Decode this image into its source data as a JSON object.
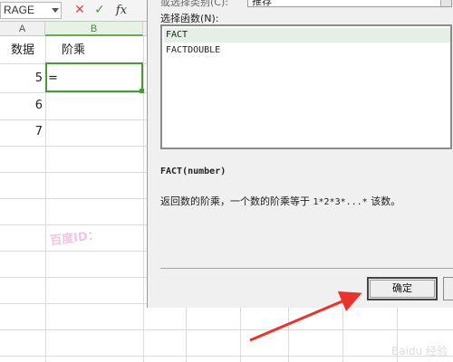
{
  "formula_bar": {
    "name_box": "RAGE",
    "cancel_icon": "✕",
    "enter_icon": "✓",
    "fx_label": "fx"
  },
  "spreadsheet": {
    "columns": [
      "A",
      "B"
    ],
    "rows": [
      {
        "a": "数据",
        "b": "阶乘"
      },
      {
        "a": "5",
        "b": "="
      },
      {
        "a": "6",
        "b": ""
      },
      {
        "a": "7",
        "b": ""
      }
    ],
    "accent_color": "#4a9a3a"
  },
  "dialog": {
    "category_label": "或选择类别(C):",
    "category_value": "推荐",
    "select_function_label": "选择函数(N):",
    "functions": [
      "FACT",
      "FACTDOUBLE"
    ],
    "selected_function": "FACT",
    "signature": "FACT(number)",
    "description_text": "返回数的阶乘，一个数的阶乘等于",
    "description_formula": "1*2*3*...*",
    "description_suffix": "该数。",
    "ok_label": "确定"
  },
  "overlays": {
    "watermark": "百度ID：",
    "arrow_color": "#e8342c",
    "site_watermark": "Baidu 经验"
  }
}
